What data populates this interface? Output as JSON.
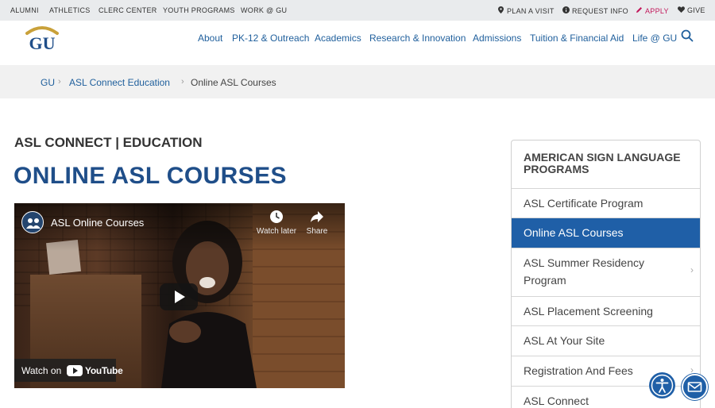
{
  "utility": {
    "left_links": [
      "ALUMNI",
      "ATHLETICS",
      "CLERC CENTER",
      "YOUTH PROGRAMS",
      "WORK @ GU"
    ],
    "right_links": [
      {
        "label": "PLAN A VISIT",
        "icon": "map-pin-icon"
      },
      {
        "label": "REQUEST INFO",
        "icon": "info-icon"
      },
      {
        "label": "APPLY",
        "icon": "pencil-icon"
      },
      {
        "label": "GIVE",
        "icon": "heart-icon"
      }
    ]
  },
  "logo": {
    "text": "GU",
    "colors": {
      "gold": "#c9a13a",
      "blue": "#1f4e89"
    }
  },
  "nav": {
    "items": [
      "About",
      "PK-12 & Outreach",
      "Academics",
      "Research & Innovation",
      "Admissions",
      "Tuition & Financial Aid",
      "Life @ GU"
    ],
    "search_icon": "search-icon"
  },
  "breadcrumb": {
    "items": [
      "GU",
      "ASL Connect Education"
    ],
    "separator": "›",
    "current": "Online ASL Courses"
  },
  "main": {
    "eyebrow": "ASL CONNECT | EDUCATION",
    "title": "ONLINE ASL COURSES"
  },
  "video": {
    "title": "ASL Online Courses",
    "watch_later": "Watch later",
    "share": "Share",
    "watch_on": "Watch on",
    "youtube": "YouTube"
  },
  "sidebar": {
    "heading": "AMERICAN SIGN LANGUAGE PROGRAMS",
    "items": [
      {
        "label": "ASL Certificate Program",
        "active": false,
        "chevron": false
      },
      {
        "label": "Online ASL Courses",
        "active": true,
        "chevron": false
      },
      {
        "label": "ASL Summer Residency Program",
        "active": false,
        "chevron": true
      },
      {
        "label": "ASL Placement Screening",
        "active": false,
        "chevron": false
      },
      {
        "label": "ASL At Your Site",
        "active": false,
        "chevron": false
      },
      {
        "label": "Registration And Fees",
        "active": false,
        "chevron": true
      },
      {
        "label": "ASL Connect",
        "active": false,
        "chevron": false
      }
    ],
    "chevron": "›"
  },
  "floating": {
    "accessibility_icon": "accessibility-icon",
    "mail_icon": "mail-icon"
  },
  "colors": {
    "primary_blue": "#1f5fa7",
    "link_blue": "#1f5f9c",
    "title_blue": "#1f4e89",
    "apply_pink": "#c2185b"
  }
}
